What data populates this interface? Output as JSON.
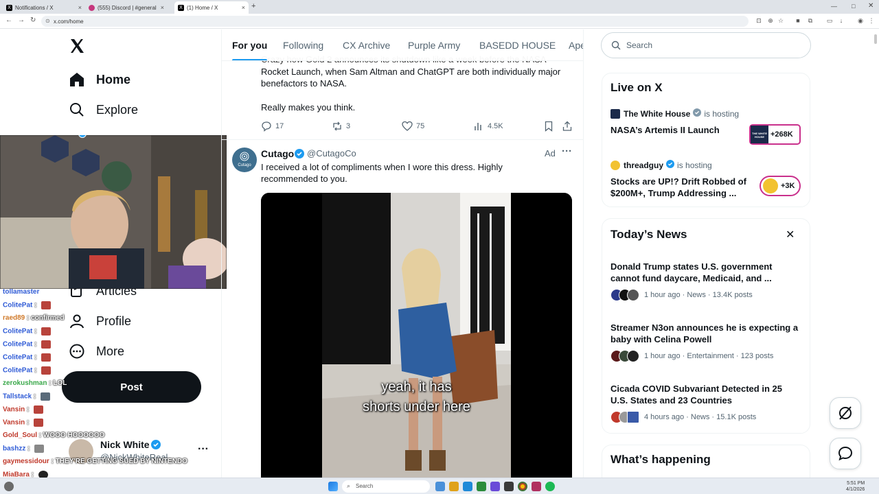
{
  "browser": {
    "tabs": [
      {
        "label": "Notifications / X",
        "active": false
      },
      {
        "label": "(555) Discord | #general",
        "active": false
      },
      {
        "label": "(1) Home / X",
        "active": true
      }
    ],
    "new_tab": "+",
    "url": "x.com/home"
  },
  "nav": {
    "items": [
      {
        "label": "Home",
        "icon": "home-icon"
      },
      {
        "label": "Explore",
        "icon": "search-icon"
      },
      {
        "label": "Articles",
        "icon": "articles-icon"
      },
      {
        "label": "Profile",
        "icon": "profile-icon"
      },
      {
        "label": "More",
        "icon": "more-icon"
      }
    ],
    "notification_badge": "1",
    "post_label": "Post",
    "account": {
      "name": "Nick White",
      "handle": "@NickWhiteReal"
    }
  },
  "chat": [
    {
      "user": "ColitePat",
      "color": "#2f5bd6",
      "msg": ""
    },
    {
      "user": "raed89",
      "color": "#d07a2a",
      "msg": "confirmed"
    },
    {
      "user": "ColitePat",
      "color": "#2f5bd6",
      "msg": ""
    },
    {
      "user": "ColitePat",
      "color": "#2f5bd6",
      "msg": ""
    },
    {
      "user": "ColitePat",
      "color": "#2f5bd6",
      "msg": ""
    },
    {
      "user": "ColitePat",
      "color": "#2f5bd6",
      "msg": ""
    },
    {
      "user": "zerokushman",
      "color": "#3aa84a",
      "msg": "LOL"
    },
    {
      "user": "Tallstack",
      "color": "#2f5bd6",
      "msg": ""
    },
    {
      "user": "Vansin",
      "color": "#c0392b",
      "msg": ""
    },
    {
      "user": "Vansin",
      "color": "#c0392b",
      "msg": ""
    },
    {
      "user": "Gold_Soul",
      "color": "#c0392b",
      "msg": "WOOO HOOOOOO"
    },
    {
      "user": "bashzz",
      "color": "#2f5bd6",
      "msg": ""
    },
    {
      "user": "gaymessidour",
      "color": "#c0392b",
      "msg": "THEY'RE GETTING SUED BY NINTENDO"
    },
    {
      "user": "MiaBara",
      "color": "#c0392b",
      "msg": ""
    }
  ],
  "feed": {
    "tabs": [
      "For you",
      "Following",
      "CX Archive",
      "Purple Army",
      "BASEDD HOUSE",
      "Ape"
    ],
    "active_tab": "For you",
    "tweet1": {
      "text_partial": "Crazy how Gold 2 announces its shutdown like a week before the NASA",
      "text_line2": "Rocket Launch, when Sam Altman and ChatGPT are both individually major",
      "text_line3": "benefactors to NASA.",
      "text_line4": "Really makes you think.",
      "replies": "17",
      "reposts": "3",
      "likes": "75",
      "views": "4.5K"
    },
    "tweet2": {
      "name": "Cutago",
      "handle": "@CutagoCo",
      "avatar_text": "Cutago",
      "ad_label": "Ad",
      "text_line1": "I received a lot of compliments when I wore this dress. Highly",
      "text_line2": "recommended to you.",
      "caption_line1": "yeah, it has",
      "caption_line2": "shorts under here"
    }
  },
  "sidebar": {
    "search_placeholder": "Search",
    "live": {
      "title": "Live on X",
      "items": [
        {
          "host": "The White House",
          "suffix": "is hosting",
          "title": "NASA’s Artemis II Launch",
          "count": "+268K",
          "thumb_text": "THE WHITE HOUSE"
        },
        {
          "host": "threadguy",
          "suffix": "is hosting",
          "title_line1": "Stocks are UP!? Drift Robbed of",
          "title_line2": "$200M+, Trump Addressing ...",
          "count": "+3K"
        }
      ]
    },
    "news": {
      "title": "Today’s News",
      "items": [
        {
          "title_line1": "Donald Trump states U.S. government",
          "title_line2": "cannot fund daycare, Medicaid, and ...",
          "meta": "1 hour ago · News · 13.4K posts"
        },
        {
          "title_line1": "Streamer N3on announces he is expecting a",
          "title_line2": "baby with Celina Powell",
          "meta": "1 hour ago · Entertainment · 123 posts"
        },
        {
          "title_line1": "Cicada COVID Subvariant Detected in 25",
          "title_line2": "U.S. States and 23 Countries",
          "meta": "4 hours ago · News · 15.1K posts"
        }
      ]
    },
    "whats_happening": "What’s happening"
  },
  "taskbar": {
    "search_placeholder": "Search",
    "time": "5:51 PM",
    "date": "4/1/2026"
  },
  "colors": {
    "accent": "#1d9bf0",
    "text": "#0f1419",
    "muted": "#536471",
    "live_border": "#c9308c"
  }
}
